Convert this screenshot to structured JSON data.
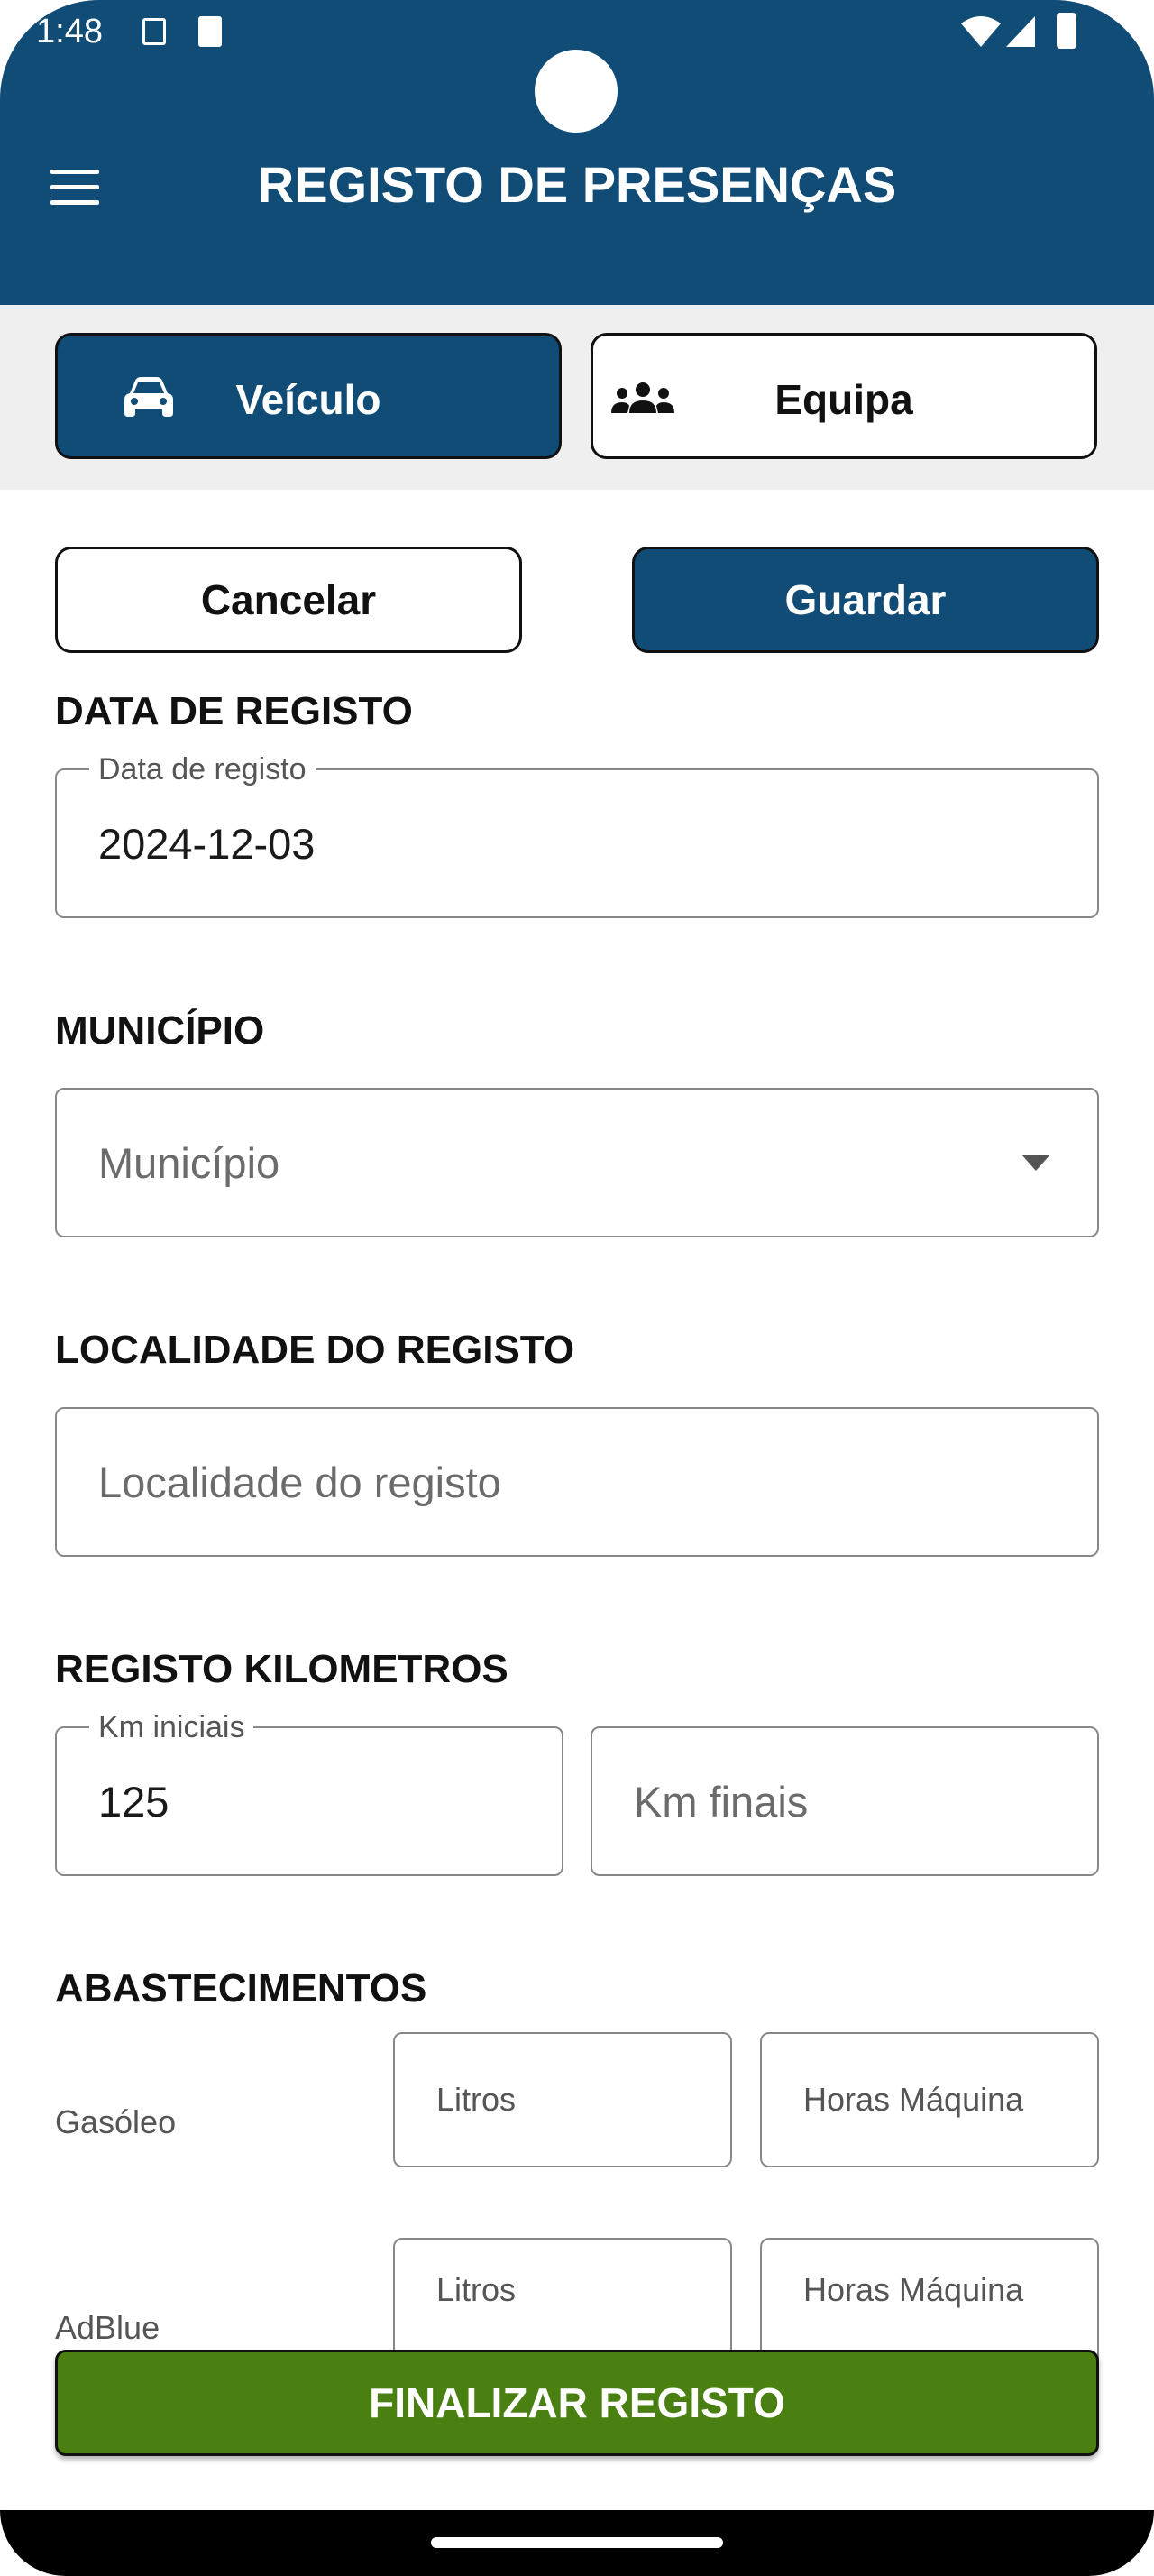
{
  "status_bar": {
    "time": "1:48"
  },
  "header": {
    "title": "REGISTO DE PRESENÇAS"
  },
  "tabs": [
    {
      "label": "Veículo",
      "icon": "car-icon",
      "active": true
    },
    {
      "label": "Equipa",
      "icon": "group-icon",
      "active": false
    }
  ],
  "actions": {
    "cancel_label": "Cancelar",
    "save_label": "Guardar"
  },
  "data_registo": {
    "section_label": "DATA DE REGISTO",
    "field_label": "Data de registo",
    "value": "2024-12-03"
  },
  "municipio": {
    "section_label": "MUNICÍPIO",
    "placeholder": "Município"
  },
  "localidade": {
    "section_label": "LOCALIDADE DO REGISTO",
    "placeholder": "Localidade do registo"
  },
  "kilometros": {
    "section_label": "REGISTO KILOMETROS",
    "km_iniciais_label": "Km iniciais",
    "km_iniciais_value": "125",
    "km_finais_placeholder": "Km finais"
  },
  "abastecimentos": {
    "section_label": "ABASTECIMENTOS",
    "rows": [
      {
        "label": "Gasóleo",
        "litros_placeholder": "Litros",
        "horas_placeholder": "Horas Máquina"
      },
      {
        "label": "AdBlue",
        "litros_placeholder": "Litros",
        "horas_placeholder": "Horas Máquina"
      }
    ]
  },
  "footer": {
    "finalize_label": "FINALIZAR REGISTO"
  },
  "colors": {
    "primary": "#114c77",
    "success": "#4a7f12",
    "strip": "#efefef"
  }
}
